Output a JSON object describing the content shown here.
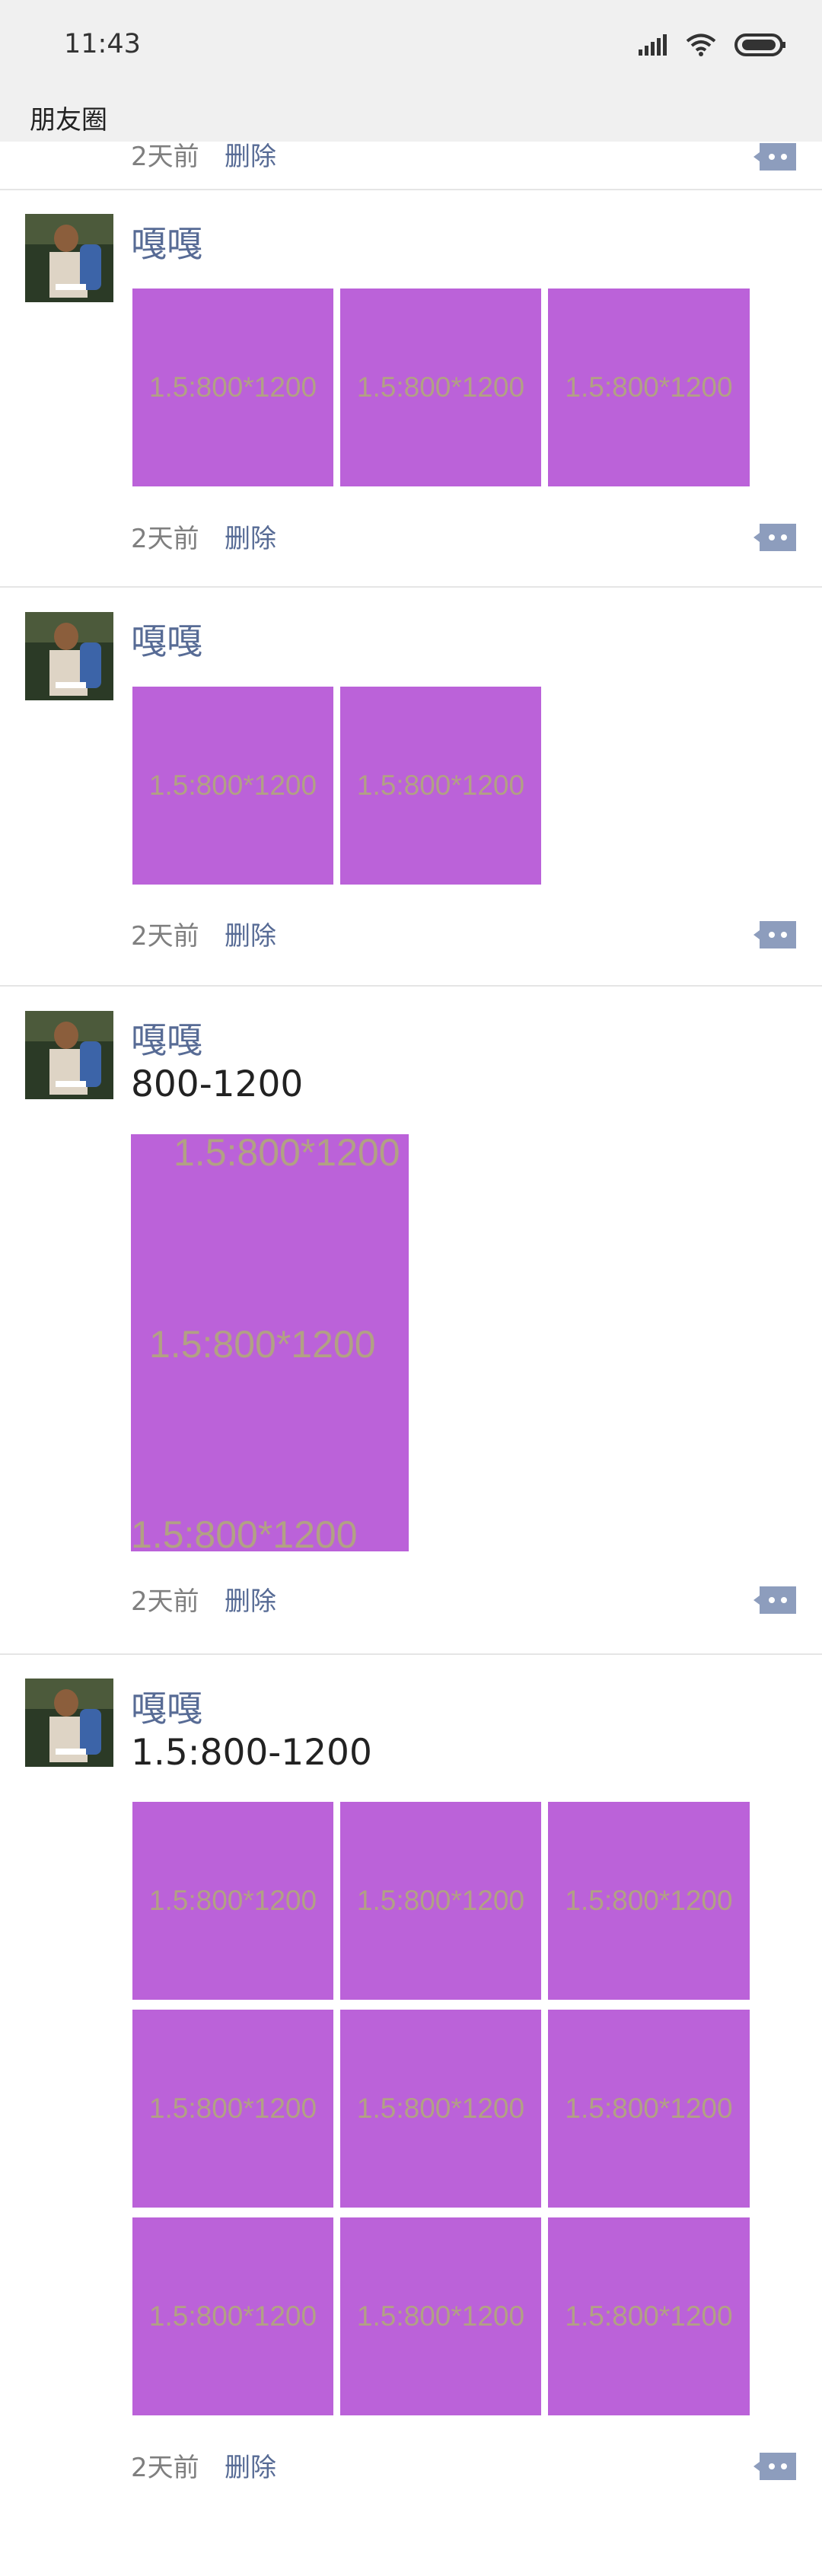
{
  "status_bar": {
    "time": "11:43",
    "icons": [
      "signal-icon",
      "wifi-icon",
      "battery-icon"
    ]
  },
  "header": {
    "title": "朋友圈"
  },
  "partial_item": {
    "timestamp": "2天前",
    "delete_label": "删除"
  },
  "photo_label": "1.5:800*1200",
  "feed": [
    {
      "username": "嘎嘎",
      "text": "",
      "timestamp": "2天前",
      "delete_label": "删除",
      "photo_count": 3
    },
    {
      "username": "嘎嘎",
      "text": "",
      "timestamp": "2天前",
      "delete_label": "删除",
      "photo_count": 2
    },
    {
      "username": "嘎嘎",
      "text": "800-1200",
      "timestamp": "2天前",
      "delete_label": "删除",
      "photo_count": 1,
      "photo_labels": [
        "1.5:800*1200",
        "1.5:800*1200",
        "1.5:800*1200"
      ]
    },
    {
      "username": "嘎嘎",
      "text": "1.5:800-1200",
      "timestamp": "2天前",
      "delete_label": "删除",
      "photo_count": 9
    }
  ],
  "colors": {
    "photo_fill": "#bb62d9",
    "photo_text": "#b2a184",
    "username": "#576b95",
    "link": "#576b95",
    "meta_text": "#7f7f7f",
    "header_bg": "#f0f0f0",
    "comment_button": "#8d9dbd"
  }
}
